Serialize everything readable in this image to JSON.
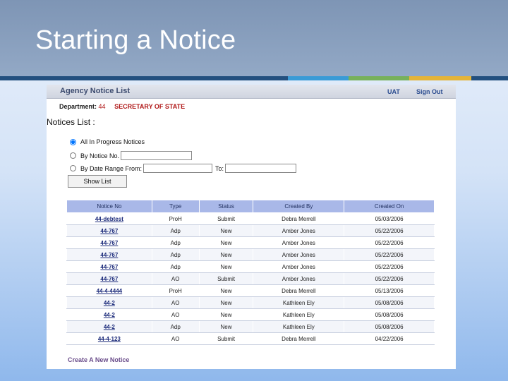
{
  "slide": {
    "title": "Starting a Notice"
  },
  "app": {
    "title": "Agency Notice List",
    "env_label": "UAT",
    "signout_label": "Sign Out",
    "department_label": "Department:",
    "department_code": "44",
    "department_name": "SECRETARY OF STATE",
    "notices_list_label": "Notices List :",
    "filters": {
      "all_label": "All In Progress Notices",
      "by_no_label": "By Notice No.",
      "by_date_label": "By Date Range From:",
      "to_label": "To:",
      "notice_no_value": "",
      "date_from_value": "",
      "date_to_value": "",
      "selected": "all"
    },
    "show_button": "Show List",
    "table": {
      "headers": [
        "Notice No",
        "Type",
        "Status",
        "Created By",
        "Created On"
      ],
      "rows": [
        [
          "44-debtest",
          "ProH",
          "Submit",
          "Debra Merrell",
          "05/03/2006"
        ],
        [
          "44-767",
          "Adp",
          "New",
          "Amber Jones",
          "05/22/2006"
        ],
        [
          "44-767",
          "Adp",
          "New",
          "Amber Jones",
          "05/22/2006"
        ],
        [
          "44-767",
          "Adp",
          "New",
          "Amber Jones",
          "05/22/2006"
        ],
        [
          "44-767",
          "Adp",
          "New",
          "Amber Jones",
          "05/22/2006"
        ],
        [
          "44-767",
          "AO",
          "Submit",
          "Amber Jones",
          "05/22/2006"
        ],
        [
          "44-4-4444",
          "ProH",
          "New",
          "Debra Merrell",
          "05/13/2006"
        ],
        [
          "44-2",
          "AO",
          "New",
          "Kathleen Ely",
          "05/08/2006"
        ],
        [
          "44-2",
          "AO",
          "New",
          "Kathleen Ely",
          "05/08/2006"
        ],
        [
          "44-2",
          "Adp",
          "New",
          "Kathleen Ely",
          "05/08/2006"
        ],
        [
          "44-4-123",
          "AO",
          "Submit",
          "Debra Merrell",
          "04/22/2006"
        ]
      ]
    },
    "create_link": "Create A New Notice"
  }
}
